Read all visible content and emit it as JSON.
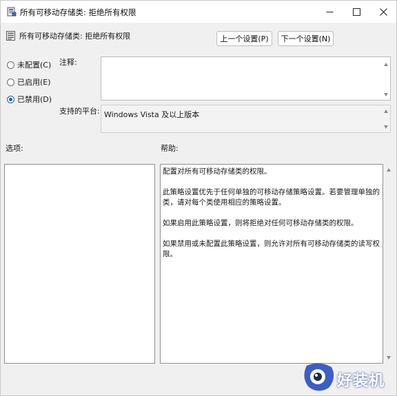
{
  "window": {
    "title": "所有可移动存储类: 拒绝所有权限"
  },
  "header": {
    "policy_title": "所有可移动存储类: 拒绝所有权限",
    "prev_button": "上一个设置(P)",
    "next_button": "下一个设置(N)"
  },
  "state": {
    "options": [
      {
        "label": "未配置(C)",
        "selected": false
      },
      {
        "label": "已启用(E)",
        "selected": false
      },
      {
        "label": "已禁用(D)",
        "selected": true
      }
    ]
  },
  "comment": {
    "label": "注释:",
    "value": ""
  },
  "platform": {
    "label": "支持的平台:",
    "value": "Windows Vista 及以上版本"
  },
  "options_panel": {
    "label": "选项:"
  },
  "help_panel": {
    "label": "帮助:",
    "paragraphs": [
      "配置对所有可移动存储类的权限。",
      "此策略设置优先于任何单独的可移动存储策略设置。若要管理单独的类，请对每个类使用相应的策略设置。",
      "如果启用此策略设置，则将拒绝对任何可移动存储类的权限。",
      "如果禁用或未配置此策略设置，则允许对所有可移动存储类的读写权限。"
    ]
  },
  "watermark": {
    "text": "好装机"
  },
  "colors": {
    "accent": "#1a5fb4",
    "window_bg": "#f0f0f0"
  }
}
